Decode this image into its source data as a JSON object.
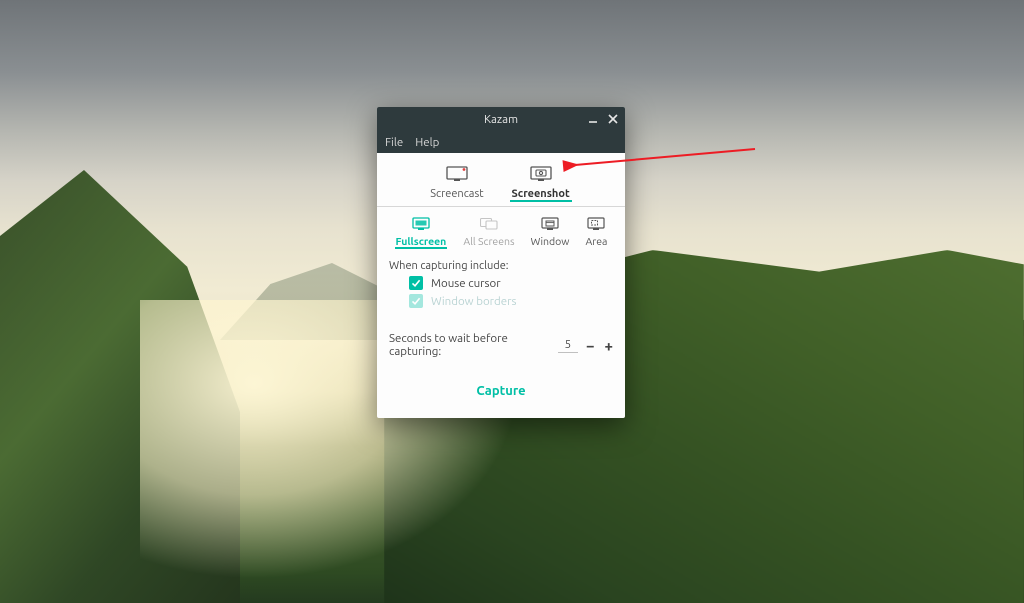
{
  "window": {
    "title": "Kazam",
    "menus": {
      "file": "File",
      "help": "Help"
    },
    "controls": {
      "minimize": "minimize",
      "close": "close"
    }
  },
  "tabs": {
    "screencast": "Screencast",
    "screenshot": "Screenshot",
    "active": "screenshot"
  },
  "modes": {
    "fullscreen": "Fullscreen",
    "all_screens": "All Screens",
    "window": "Window",
    "area": "Area",
    "active": "fullscreen"
  },
  "options": {
    "section_label": "When capturing include:",
    "mouse_cursor": {
      "label": "Mouse cursor",
      "checked": true,
      "enabled": true
    },
    "window_borders": {
      "label": "Window borders",
      "checked": true,
      "enabled": false
    }
  },
  "delay": {
    "label": "Seconds to wait before capturing:",
    "value": "5"
  },
  "capture": {
    "label": "Capture"
  },
  "colors": {
    "accent": "#00bfa5",
    "titlebar": "#2e3a3d",
    "annotation": "#ed1c24"
  }
}
